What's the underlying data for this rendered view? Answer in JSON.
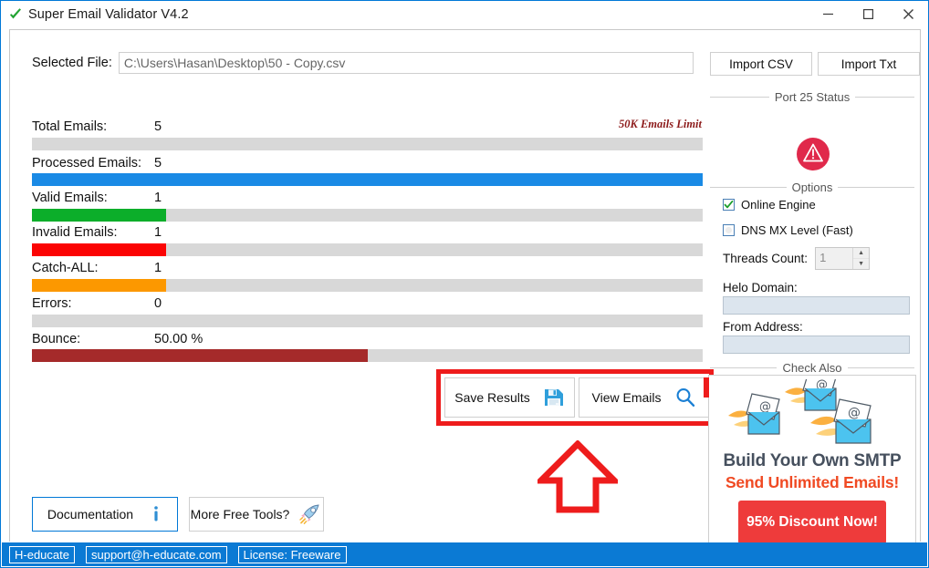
{
  "window": {
    "title": "Super Email Validator V4.2",
    "app_icon": "green-check-icon",
    "controls": {
      "minimize": "—",
      "maximize": "☐",
      "close": "✕"
    }
  },
  "file": {
    "label": "Selected File:",
    "value": "C:\\Users\\Hasan\\Desktop\\50 - Copy.csv",
    "placeholder": ""
  },
  "limit_note": "50K Emails Limit",
  "stats": [
    {
      "label": "Total Emails:",
      "value": "5",
      "percent": 0,
      "color": "#d8d8d8"
    },
    {
      "label": "Processed Emails:",
      "value": "5",
      "percent": 100,
      "color": "#1a8ae5"
    },
    {
      "label": "Valid Emails:",
      "value": "1",
      "percent": 20,
      "color": "#0cae2a"
    },
    {
      "label": "Invalid Emails:",
      "value": "1",
      "percent": 20,
      "color": "#fb0404"
    },
    {
      "label": "Catch-ALL:",
      "value": "1",
      "percent": 20,
      "color": "#fc9800"
    },
    {
      "label": "Errors:",
      "value": "0",
      "percent": 0,
      "color": "#d8d8d8"
    },
    {
      "label": "Bounce:",
      "value": "50.00 %",
      "percent": 50,
      "color": "#a52a2a"
    }
  ],
  "actions": {
    "save_label": "Save Results",
    "save_icon": "floppy-disk-icon",
    "view_label": "View Emails",
    "view_icon": "magnifier-icon",
    "highlight_color": "#ee1c1c"
  },
  "annotation": {
    "arrow": "up-arrow-annotation",
    "color": "#ee1c1c"
  },
  "bottom": {
    "documentation_label": "Documentation",
    "documentation_icon": "info-icon",
    "tools_label": "More Free Tools?",
    "tools_icon": "rocket-icon"
  },
  "right": {
    "import_csv": "Import CSV",
    "import_txt": "Import Txt",
    "port_group": "Port 25 Status",
    "port_icon": "warning-circle-icon",
    "port_status_color": "#e0294b",
    "options_group": "Options",
    "online_engine": "Online Engine",
    "online_engine_checked": true,
    "dns_mx": "DNS MX Level (Fast)",
    "dns_mx_checked": false,
    "threads_label": "Threads Count:",
    "threads_value": "1",
    "helo_label": "Helo Domain:",
    "helo_value": "",
    "from_label": "From Address:",
    "from_value": "",
    "check_also_group": "Check Also"
  },
  "ad": {
    "title": "Build Your Own SMTP",
    "subtitle": "Send Unlimited Emails!",
    "cta": "95% Discount Now!",
    "cta_color": "#ee3b3b",
    "graphic": "flying-envelopes-icon"
  },
  "statusbar": {
    "brand": "H-educate",
    "email": "support@h-educate.com",
    "license": "License: Freeware",
    "color": "#0b7ad4"
  }
}
